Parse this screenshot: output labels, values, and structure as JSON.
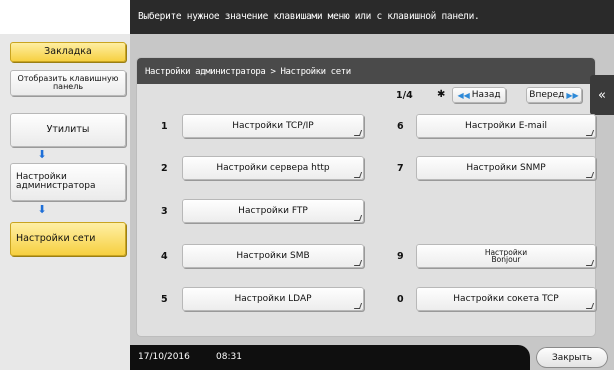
{
  "message": "Выберите нужное значение клавишами меню или с клавишной панели.",
  "left_panel": {
    "bookmark_label": "Закладка",
    "show_keypad_label": "Отобразить клавишную панель",
    "breadcrumbs": [
      {
        "label": "Утилиты",
        "active": false
      },
      {
        "label": "Настройки администратора",
        "active": false
      },
      {
        "label": "Настройки сети",
        "active": true
      }
    ]
  },
  "panel": {
    "title": "Настройки администратора > Настройки сети",
    "page_indicator": "1/4",
    "star": "✱",
    "back_label": "Назад",
    "forward_label": "Вперед",
    "items": [
      {
        "num": "1",
        "label": "Настройки TCP/IP"
      },
      {
        "num": "2",
        "label": "Настройки сервера http"
      },
      {
        "num": "3",
        "label": "Настройки FTP"
      },
      {
        "num": "4",
        "label": "Настройки SMB"
      },
      {
        "num": "5",
        "label": "Настройки LDAP"
      },
      {
        "num": "6",
        "label": "Настройки E-mail"
      },
      {
        "num": "7",
        "label": "Настройки SNMP"
      },
      {
        "num": "9",
        "label": "Настройки Bonjour"
      },
      {
        "num": "0",
        "label": "Настройки сокета TCP"
      }
    ]
  },
  "status": {
    "date": "17/10/2016",
    "time": "08:31",
    "close_label": "Закрыть"
  },
  "colors": {
    "accent_yellow": "#f6cf3d",
    "arrow_blue": "#1e6fd8",
    "header_dark": "#4a4a4a"
  }
}
